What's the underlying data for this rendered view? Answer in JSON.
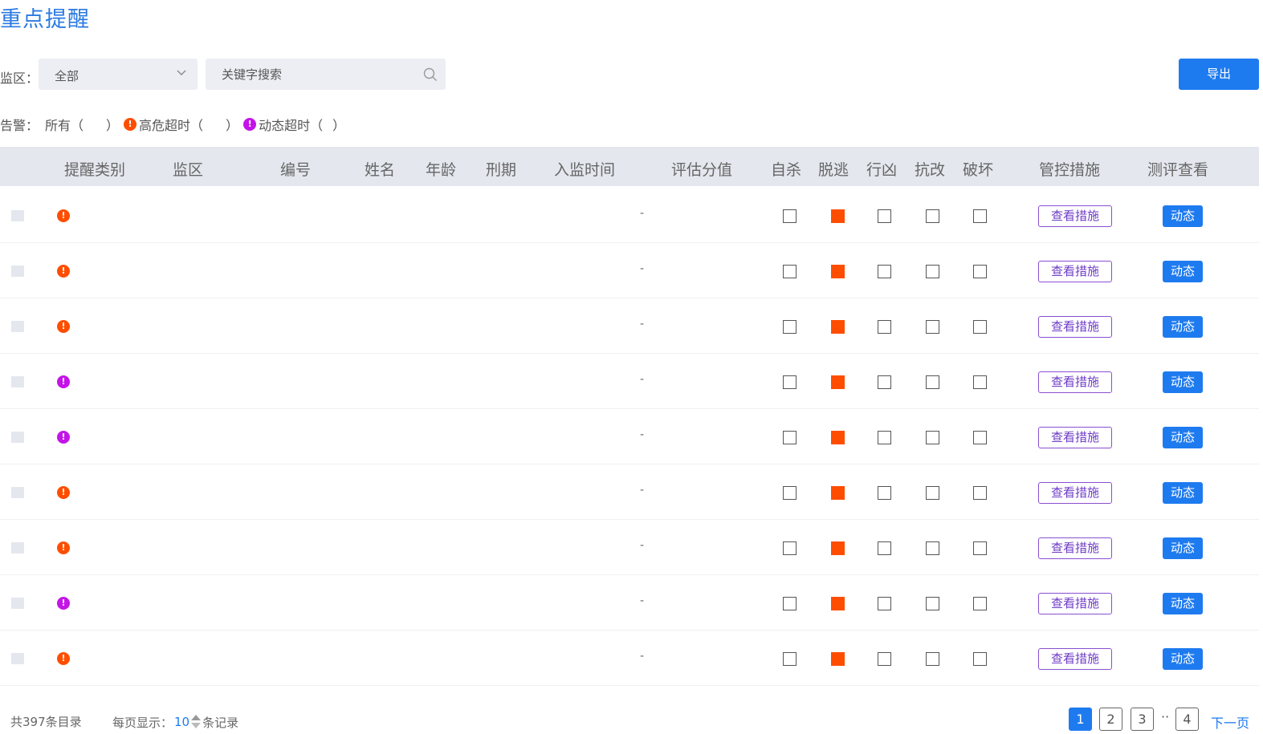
{
  "page": {
    "title": "重点提醒"
  },
  "filters": {
    "area_label": "监区：",
    "area_value": "全部",
    "search_placeholder": "关键字搜索",
    "export_label": "导出"
  },
  "alarm": {
    "label": "告警：",
    "all": "所有（",
    "all_close": "）",
    "high_risk": "高危超时（",
    "high_risk_close": "）",
    "dynamic": "动态超时（",
    "dynamic_close": "）",
    "high_risk_color": "#ff4d00",
    "dynamic_color": "#c414e8"
  },
  "table": {
    "headers": [
      "提醒类别",
      "监区",
      "编号",
      "姓名",
      "年龄",
      "刑期",
      "入监时间",
      "评估分值",
      "自杀",
      "脱逃",
      "行凶",
      "抗改",
      "破坏",
      "管控措施",
      "测评查看"
    ],
    "rows": [
      {
        "category": "red",
        "score": "-",
        "checks": [
          false,
          true,
          false,
          false,
          false
        ],
        "measure": "查看措施",
        "dynamic": "动态"
      },
      {
        "category": "red",
        "score": "-",
        "checks": [
          false,
          true,
          false,
          false,
          false
        ],
        "measure": "查看措施",
        "dynamic": "动态"
      },
      {
        "category": "red",
        "score": "-",
        "checks": [
          false,
          true,
          false,
          false,
          false
        ],
        "measure": "查看措施",
        "dynamic": "动态"
      },
      {
        "category": "purple",
        "score": "-",
        "checks": [
          false,
          true,
          false,
          false,
          false
        ],
        "measure": "查看措施",
        "dynamic": "动态"
      },
      {
        "category": "purple",
        "score": "-",
        "checks": [
          false,
          true,
          false,
          false,
          false
        ],
        "measure": "查看措施",
        "dynamic": "动态"
      },
      {
        "category": "red",
        "score": "-",
        "checks": [
          false,
          true,
          false,
          false,
          false
        ],
        "measure": "查看措施",
        "dynamic": "动态"
      },
      {
        "category": "red",
        "score": "-",
        "checks": [
          false,
          true,
          false,
          false,
          false
        ],
        "measure": "查看措施",
        "dynamic": "动态"
      },
      {
        "category": "purple",
        "score": "-",
        "checks": [
          false,
          true,
          false,
          false,
          false
        ],
        "measure": "查看措施",
        "dynamic": "动态"
      },
      {
        "category": "red",
        "score": "-",
        "checks": [
          false,
          true,
          false,
          false,
          false
        ],
        "measure": "查看措施",
        "dynamic": "动态"
      }
    ]
  },
  "footer": {
    "total": "共397条目录",
    "page_size_label": "每页显示：",
    "page_size": "10",
    "page_size_suffix": "条记录",
    "pages": [
      "1",
      "2",
      "3",
      "4"
    ],
    "active_page": "1",
    "ellipsis": "··",
    "next": "下一页"
  },
  "colors": {
    "accent": "#1e7bef",
    "title": "#2a7ae2",
    "measure_border": "#8a4fd1"
  }
}
